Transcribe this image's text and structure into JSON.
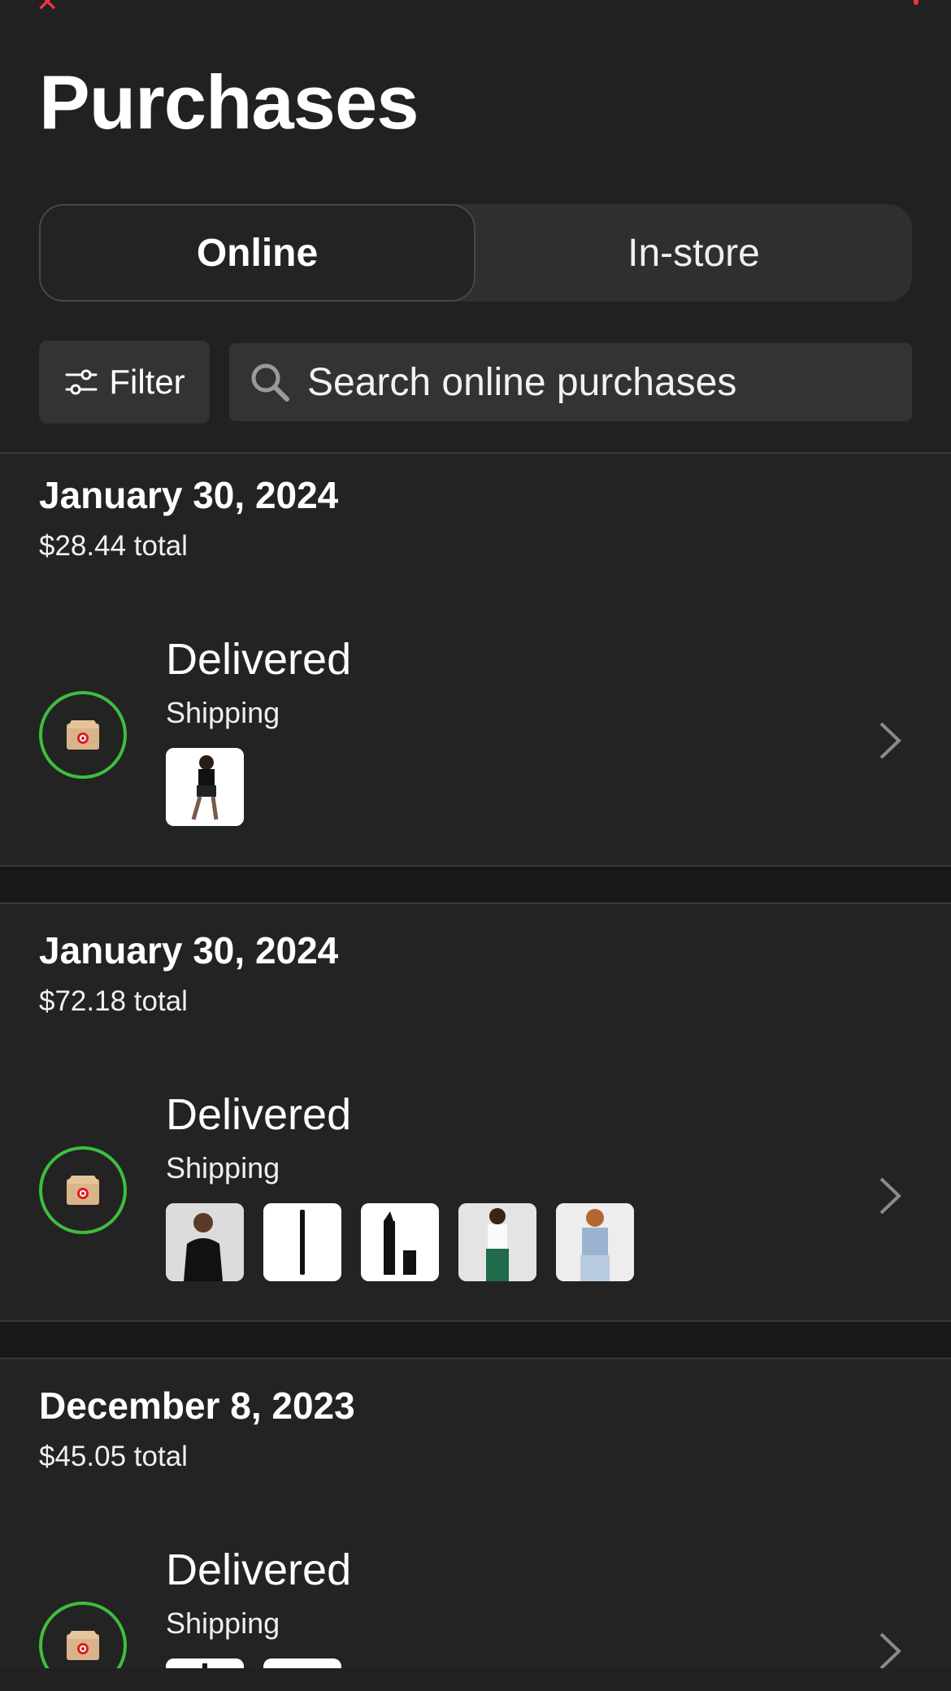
{
  "header": {
    "title": "Purchases",
    "close_icon": "close-icon",
    "more_icon": "more-icon"
  },
  "tabs": [
    {
      "label": "Online",
      "active": true
    },
    {
      "label": "In-store",
      "active": false
    }
  ],
  "toolbar": {
    "filter_label": "Filter",
    "search_placeholder": "Search online purchases"
  },
  "orders": [
    {
      "date": "January 30, 2024",
      "total": "$28.44 total",
      "status": "Delivered",
      "method": "Shipping",
      "items": [
        "dancer-outfit"
      ]
    },
    {
      "date": "January 30, 2024",
      "total": "$72.18 total",
      "status": "Delivered",
      "method": "Shipping",
      "items": [
        "black-top",
        "eyeliner-pencil",
        "lipstick",
        "white-top-green-pants",
        "denim-set"
      ]
    },
    {
      "date": "December 8, 2023",
      "total": "$45.05 total",
      "status": "Delivered",
      "method": "Shipping",
      "items": [
        "pencil",
        "item-white"
      ]
    }
  ],
  "colors": {
    "accent": "#e8383a",
    "status_ring": "#3fbd40",
    "background": "#212121"
  }
}
